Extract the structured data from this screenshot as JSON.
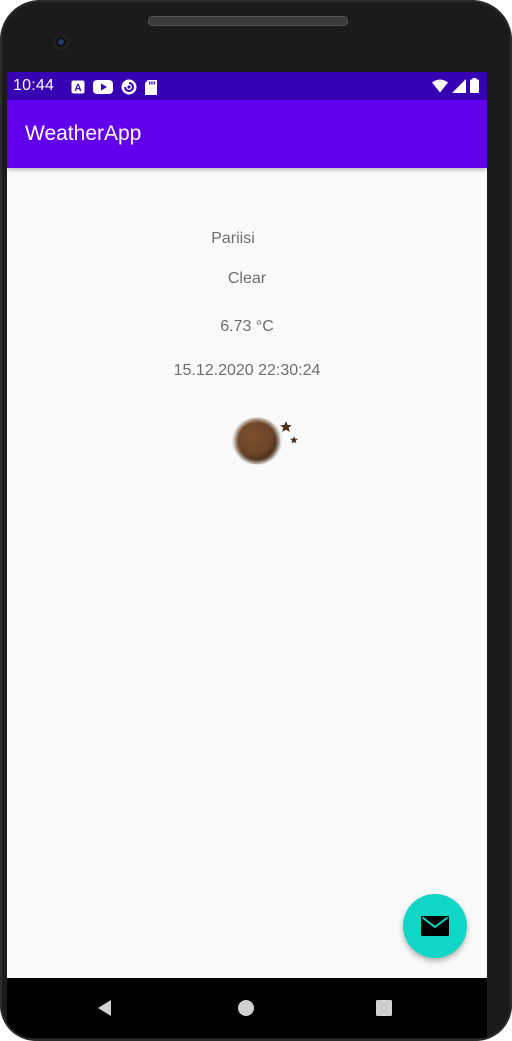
{
  "status_bar": {
    "time": "10:44",
    "left_icons": [
      "a-badge-icon",
      "youtube-icon",
      "pocket-casts-icon",
      "sd-card-icon"
    ],
    "right_icons": [
      "wifi-icon",
      "signal-icon",
      "battery-icon"
    ],
    "background_color": "#3700b3"
  },
  "app_bar": {
    "title": "WeatherApp",
    "background_color": "#6200ee"
  },
  "weather": {
    "city": "Pariisi",
    "condition": "Clear",
    "temperature": "6.73 °C",
    "datetime": "15.12.2020 22:30:24",
    "icon": "clear-night-moon-icon"
  },
  "fab": {
    "icon": "envelope-icon",
    "color": "#12d6c5"
  },
  "nav_bar": {
    "buttons": [
      "back-icon",
      "home-icon",
      "recents-icon"
    ]
  }
}
